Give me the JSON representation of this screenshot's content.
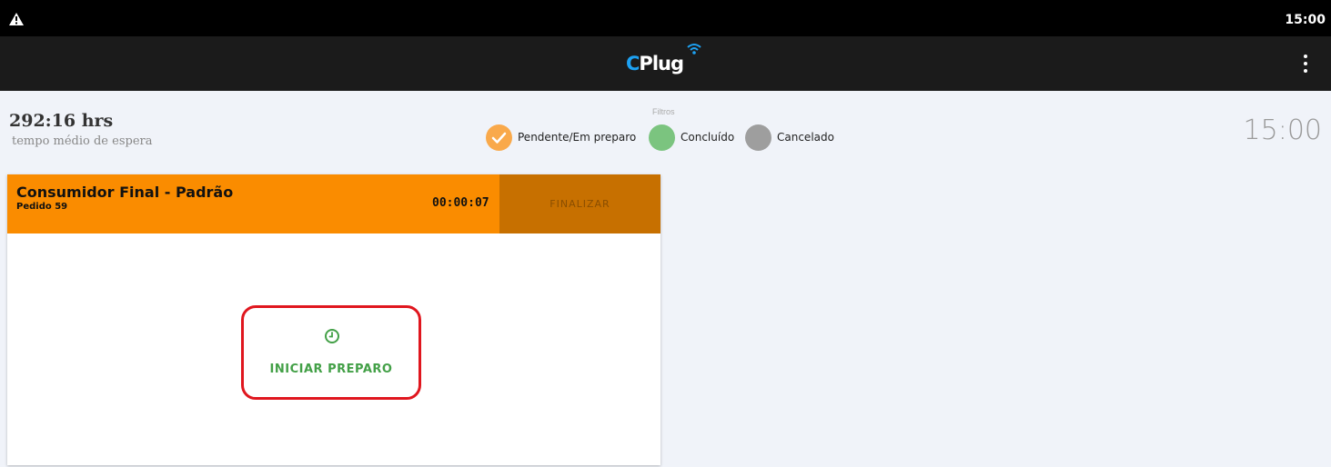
{
  "status_bar": {
    "time": "15:00",
    "warning_icon": "warning-icon"
  },
  "app_bar": {
    "logo_prefix": "C",
    "logo_text": "Plug",
    "logo_icon": "wifi-icon",
    "menu_icon": "more-vert-icon"
  },
  "summary": {
    "avg_wait_time": "292:16 hrs",
    "avg_wait_label": "tempo médio de espera",
    "clock": "15:00"
  },
  "filters": {
    "title": "Filtros",
    "items": [
      {
        "label": "Pendente/Em preparo",
        "color": "#f9a94b",
        "checked": true
      },
      {
        "label": "Concluído",
        "color": "#7bc47f",
        "checked": false
      },
      {
        "label": "Cancelado",
        "color": "#9e9e9e",
        "checked": false
      }
    ]
  },
  "order": {
    "customer": "Consumidor Final - Padrão",
    "order_number": "Pedido 59",
    "elapsed": "00:00:07",
    "finalize_label": "FINALIZAR",
    "start_label": "INICIAR PREPARO",
    "start_icon": "clock-icon",
    "header_color": "#fa8c00",
    "accent_color": "#43a047"
  }
}
